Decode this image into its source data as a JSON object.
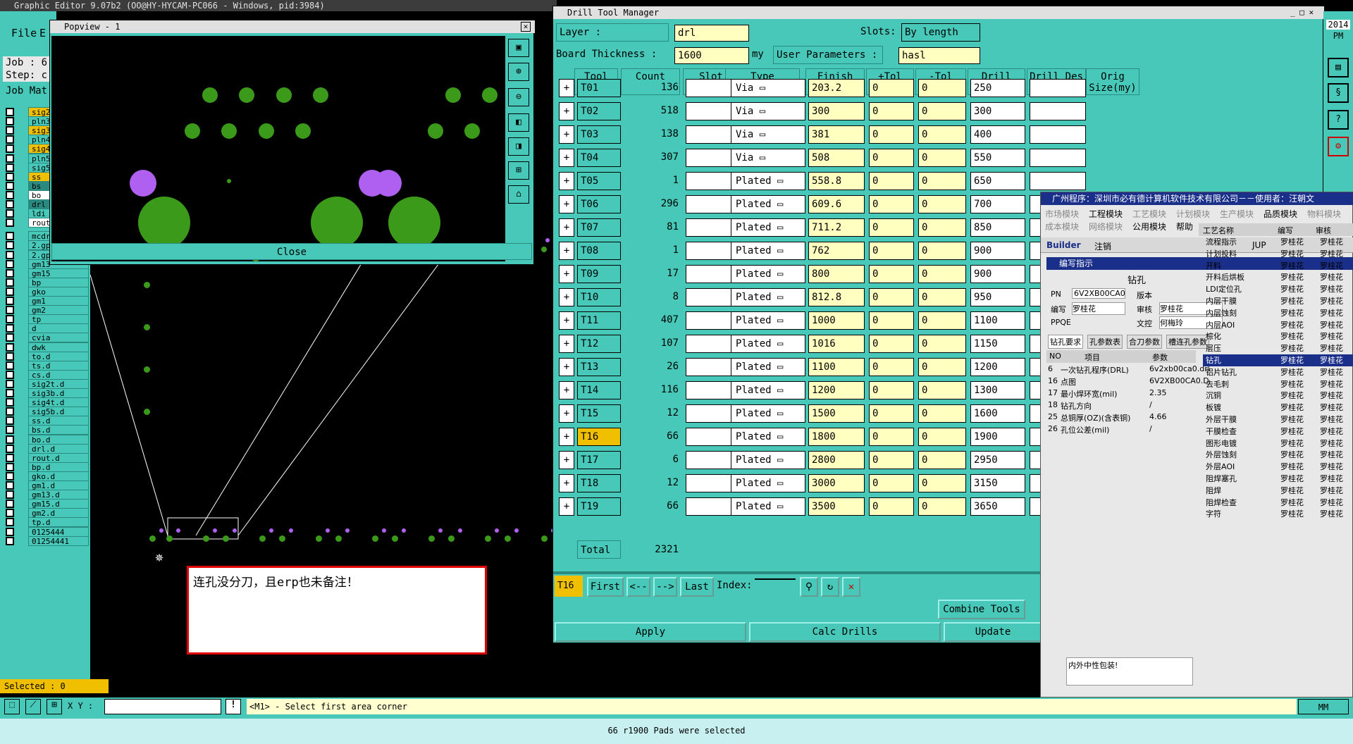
{
  "editor": {
    "title": "Graphic Editor 9.07b2 (OO@HY-HYCAM-PC066 - Windows, pid:3984)",
    "menu_file": "File",
    "menu_e": "E",
    "job_label": "Job : 6",
    "step_label": "Step: c",
    "job_mat": "Job Mat",
    "layers": [
      "sig2",
      "pln3",
      "sig3",
      "pln4",
      "sig4",
      "pln5",
      "sig5",
      "ss",
      "bs",
      "bo",
      "drl",
      "ldi",
      "rout",
      "mcdrl",
      "2.gpb",
      "2.gpt",
      "gm13",
      "gm15",
      "bp",
      "gko",
      "gm1",
      "gm2",
      "tp",
      "d",
      "cvia",
      "dwk",
      "to.d",
      "ts.d",
      "cs.d",
      "sig2t.d",
      "sig3b.d",
      "sig4t.d",
      "sig5b.d",
      "ss.d",
      "bs.d",
      "bo.d",
      "drl.d",
      "rout.d",
      "bp.d",
      "gko.d",
      "gm1.d",
      "gm13.d",
      "gm15.d",
      "gm2.d",
      "tp.d",
      "0125444",
      "01254441"
    ],
    "selected": "Selected : 0",
    "xy_label": "X Y :",
    "hint": "<M1> - Select first area corner",
    "units": "MM",
    "status": "66 r1900 Pads were selected",
    "annotation": "连孔没分刀，且erp也未备注！"
  },
  "popview": {
    "title": "Popview - 1",
    "close": "Close"
  },
  "drill": {
    "title": "Drill Tool Manager",
    "layer_label": "Layer :",
    "layer_value": "drl",
    "slots_label": "Slots:",
    "slots_value": "By length",
    "thick_label": "Board Thickness :",
    "thick_value": "1600",
    "thick_unit": "my",
    "user_label": "User Parameters :",
    "user_value": "hasl",
    "headers": [
      "Tool",
      "Count",
      "Slot Len(my)",
      "Type",
      "Finish Size(my)",
      "+Tol (my)",
      "-Tol (my)",
      "Drill Size(my)",
      "Drill Des",
      "Orig Size(my)"
    ],
    "rows": [
      [
        "T01",
        "136",
        "Via",
        "203.2",
        "0",
        "0",
        "250"
      ],
      [
        "T02",
        "518",
        "Via",
        "300",
        "0",
        "0",
        "300"
      ],
      [
        "T03",
        "138",
        "Via",
        "381",
        "0",
        "0",
        "400"
      ],
      [
        "T04",
        "307",
        "Via",
        "508",
        "0",
        "0",
        "550"
      ],
      [
        "T05",
        "1",
        "Plated",
        "558.8",
        "0",
        "0",
        "650"
      ],
      [
        "T06",
        "296",
        "Plated",
        "609.6",
        "0",
        "0",
        "700"
      ],
      [
        "T07",
        "81",
        "Plated",
        "711.2",
        "0",
        "0",
        "850"
      ],
      [
        "T08",
        "1",
        "Plated",
        "762",
        "0",
        "0",
        "900"
      ],
      [
        "T09",
        "17",
        "Plated",
        "800",
        "0",
        "0",
        "900"
      ],
      [
        "T10",
        "8",
        "Plated",
        "812.8",
        "0",
        "0",
        "950"
      ],
      [
        "T11",
        "407",
        "Plated",
        "1000",
        "0",
        "0",
        "1100"
      ],
      [
        "T12",
        "107",
        "Plated",
        "1016",
        "0",
        "0",
        "1150"
      ],
      [
        "T13",
        "26",
        "Plated",
        "1100",
        "0",
        "0",
        "1200"
      ],
      [
        "T14",
        "116",
        "Plated",
        "1200",
        "0",
        "0",
        "1300"
      ],
      [
        "T15",
        "12",
        "Plated",
        "1500",
        "0",
        "0",
        "1600"
      ],
      [
        "T16",
        "66",
        "Plated",
        "1800",
        "0",
        "0",
        "1900"
      ],
      [
        "T17",
        "6",
        "Plated",
        "2800",
        "0",
        "0",
        "2950"
      ],
      [
        "T18",
        "12",
        "Plated",
        "3000",
        "0",
        "0",
        "3150"
      ],
      [
        "T19",
        "66",
        "Plated",
        "3500",
        "0",
        "0",
        "3650"
      ]
    ],
    "total_label": "Total",
    "total_value": "2321",
    "current": "T16",
    "first": "First",
    "prev": "<--",
    "next": "-->",
    "last": "Last",
    "index": "Index:",
    "combine": "Combine Tools",
    "apply": "Apply",
    "calc": "Calc Drills",
    "update": "Update"
  },
  "erp": {
    "title": "广州程序：深圳市必有德计算机软件技术有限公司－－使用者：汪朝文",
    "menu1": [
      "市场模块",
      "工程模块",
      "工艺模块",
      "计划模块",
      "生产模块",
      "品质模块",
      "物料模块"
    ],
    "menu2": [
      "成本模块",
      "网络模块",
      "公用模块",
      "帮助"
    ],
    "toolbar": [
      "Builder",
      "注销",
      "JUP"
    ],
    "sub": "编写指示",
    "section": "钻孔",
    "pn_label": "PN",
    "pn_value": "6V2XB00CA0",
    "ver_label": "版本",
    "editor_label": "编写",
    "editor_value": "罗桂花",
    "audit_label": "审核",
    "audit_value": "罗桂花",
    "ppqe": "PPQE",
    "doc_label": "文控",
    "doc_value": "何梅玲",
    "tabs": [
      "钻孔要求",
      "孔参数表",
      "合刀参数",
      "槽连孔参数"
    ],
    "cols": [
      "NO",
      "项目",
      "参数"
    ],
    "items": [
      [
        "6",
        "一次钻孔程序(DRL)",
        "6v2xb00ca0.drl"
      ],
      [
        "16",
        "点图",
        "6V2XB00CA0.D"
      ],
      [
        "17",
        "最小焊环宽(mil)",
        "2.35"
      ],
      [
        "18",
        "钻孔方向",
        "/"
      ],
      [
        "25",
        "总铜厚(OZ)(含表铜)",
        "4.66"
      ],
      [
        "26",
        "孔位公差(mil)",
        "/"
      ]
    ],
    "proc_cols": [
      "工艺名称",
      "编写",
      "审核"
    ],
    "procs": [
      "流程指示",
      "计划投料",
      "开料",
      "开料后烘板",
      "LDI定位孔",
      "内层干膜",
      "内层蚀刻",
      "内层AOI",
      "棕化",
      "层压",
      "钻孔",
      "铝片钻孔",
      "去毛刺",
      "沉铜",
      "板镀",
      "外层干膜",
      "干膜检查",
      "图形电镀",
      "外层蚀刻",
      "外层AOI",
      "阻焊塞孔",
      "阻焊",
      "阻焊检查",
      "字符"
    ],
    "proc_person": "罗桂花",
    "note": "内外中性包装!",
    "year": "2014",
    "pm": "PM"
  }
}
